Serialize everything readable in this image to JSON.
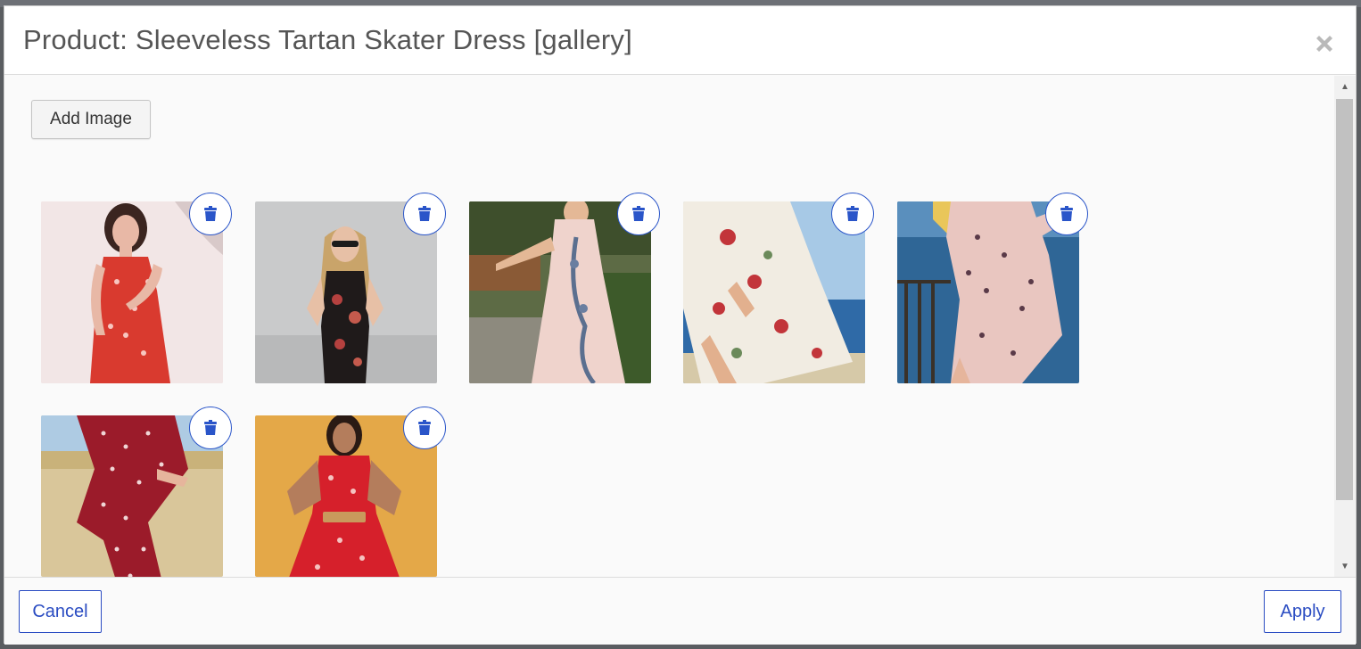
{
  "modal": {
    "title": "Product: Sleeveless Tartan Skater Dress [gallery]",
    "close_icon": "close-icon"
  },
  "toolbar": {
    "add_image_label": "Add Image"
  },
  "gallery": {
    "images": [
      {
        "name": "gallery-image-1",
        "subject": "woman in red floral sleeveless dress",
        "bg": "#e9dcdc",
        "dress": "#d93a2f"
      },
      {
        "name": "gallery-image-2",
        "subject": "woman in black floral dress with sunglasses",
        "bg": "#c8c8c8",
        "dress": "#1f1a1a"
      },
      {
        "name": "gallery-image-3",
        "subject": "woman in pale pink floral dress",
        "bg": "#4a5a3a",
        "dress": "#efd3cc"
      },
      {
        "name": "gallery-image-4",
        "subject": "woman in white floral wrap dress by the sea",
        "bg": "#3d79b8",
        "dress": "#f1ece2"
      },
      {
        "name": "gallery-image-5",
        "subject": "woman in pink floral wrap dress by railing",
        "bg": "#3a6d9e",
        "dress": "#e9c6c0"
      },
      {
        "name": "gallery-image-6",
        "subject": "woman in red polka dot dress in field",
        "bg": "#d9c69a",
        "dress": "#9b1b2a"
      },
      {
        "name": "gallery-image-7",
        "subject": "woman in red floral dress on orange background",
        "bg": "#e4a848",
        "dress": "#d6202b"
      }
    ],
    "delete_icon": "trash-icon"
  },
  "footer": {
    "cancel_label": "Cancel",
    "apply_label": "Apply"
  },
  "colors": {
    "accent": "#2a4cc2",
    "header_bg": "#ffffff",
    "body_bg": "#fafafa"
  }
}
